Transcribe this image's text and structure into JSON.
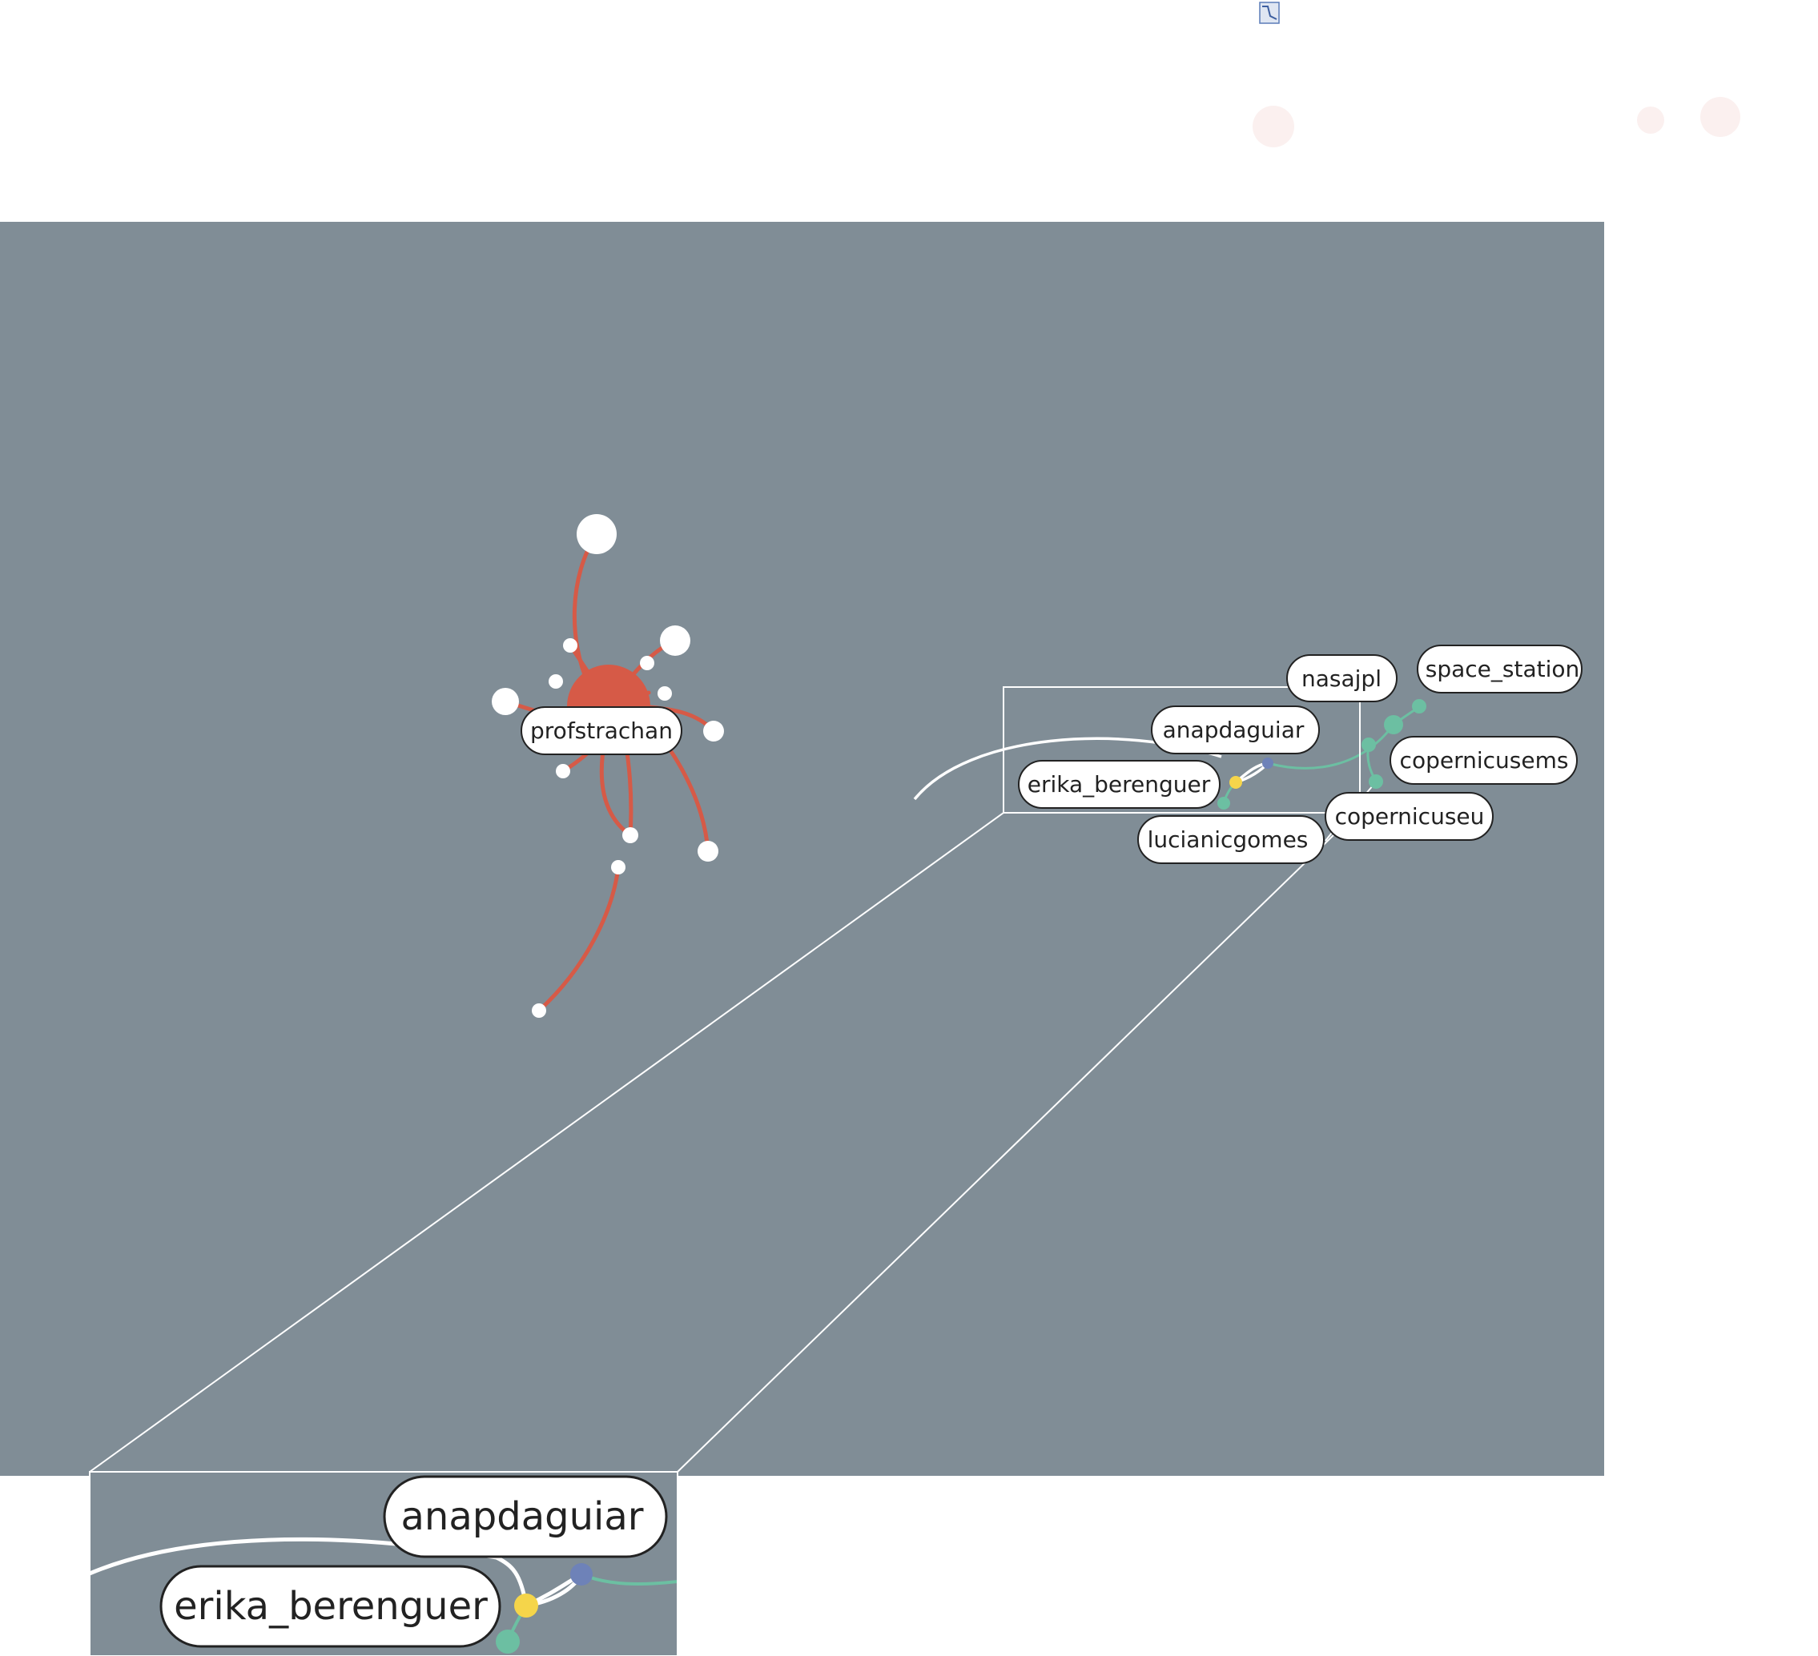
{
  "colors": {
    "canvas": "#808d96",
    "page": "#ffffff",
    "hub": "#d65a47",
    "green": "#6cbfa2",
    "blue": "#6e82b8",
    "yellow": "#f5d54a",
    "white_node": "#ffffff",
    "faint_circle": "#fbf0ef"
  },
  "icons": {
    "corner": "document-corner-icon"
  },
  "graph": {
    "hub": {
      "label": "profstrachan"
    },
    "labels": {
      "nasajpl": "nasajpl",
      "space_station": "space_station",
      "anapdaguiar": "anapdaguiar",
      "copernicusems": "copernicusems",
      "erika_berenguer": "erika_berenguer",
      "copernicuseu": "copernicuseu",
      "lucianicgomes": "lucianicgomes"
    }
  },
  "zoom_inset": {
    "labels": {
      "anapdaguiar": "anapdaguiar",
      "erika_berenguer": "erika_berenguer"
    }
  }
}
